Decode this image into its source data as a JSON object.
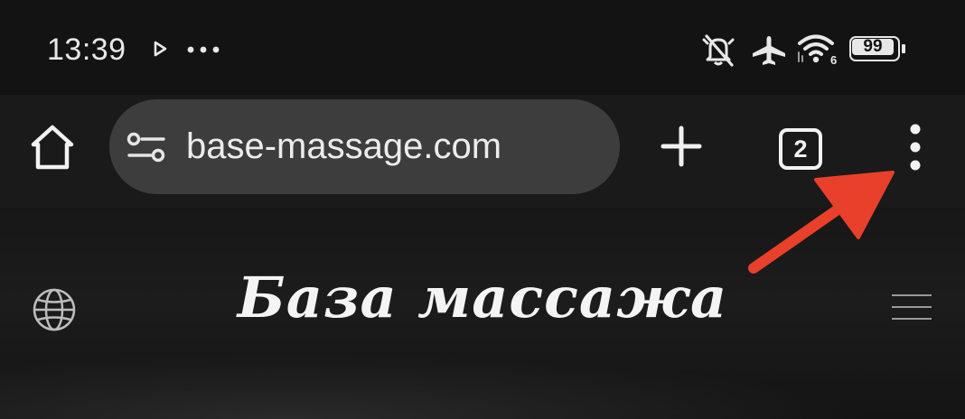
{
  "status_bar": {
    "time": "13:39",
    "icons": [
      "play-icon",
      "more-dots-icon",
      "mute-icon",
      "airplane-icon",
      "wifi-icon",
      "battery-icon"
    ],
    "wifi_badge": "6",
    "battery_level": "99"
  },
  "browser": {
    "url": "base-massage.com",
    "tab_count": "2",
    "icons": [
      "home-icon",
      "site-settings-icon",
      "plus-icon",
      "tab-switcher-icon",
      "kebab-menu-icon"
    ]
  },
  "page": {
    "logo_text": "База массажа",
    "icons": [
      "globe-icon",
      "hamburger-menu-icon"
    ]
  },
  "annotation": {
    "color": "#e8402a",
    "target": "kebab-menu-icon"
  }
}
